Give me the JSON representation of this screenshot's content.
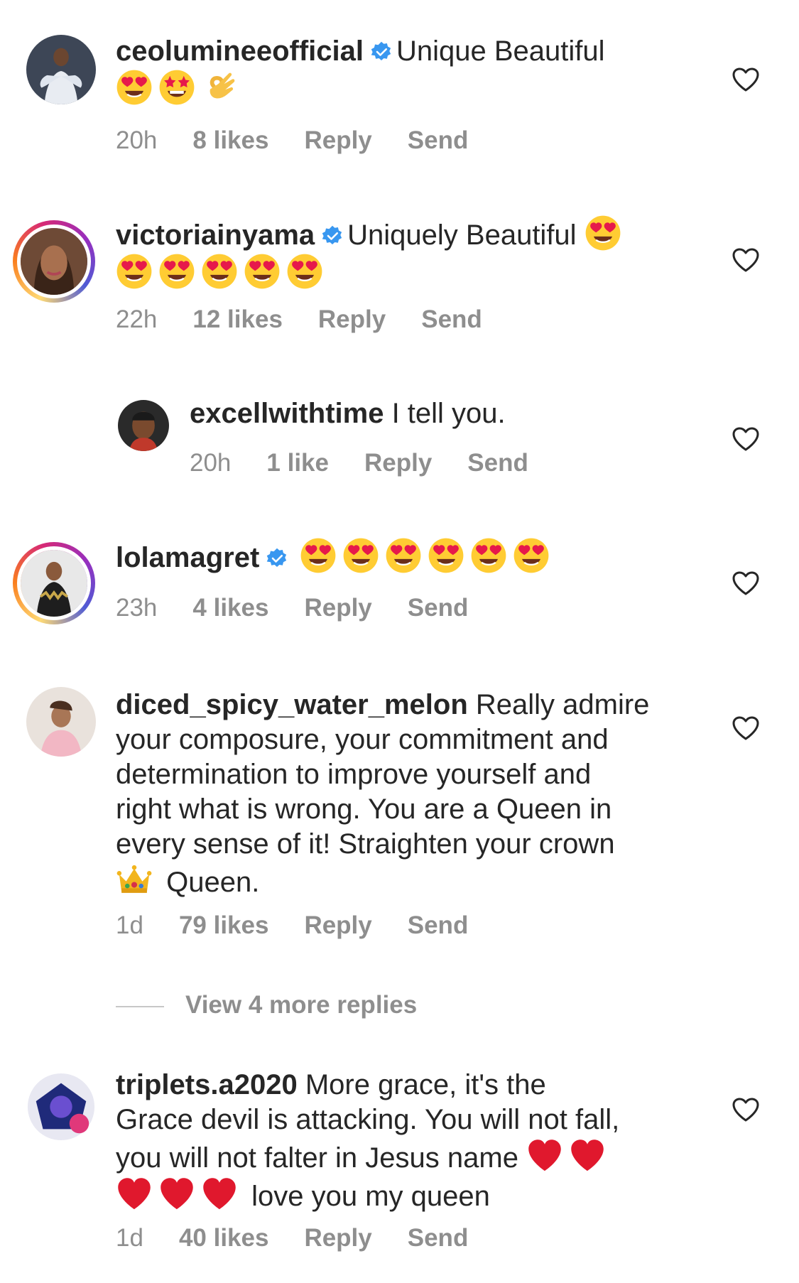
{
  "comments": [
    {
      "username": "ceolumineeofficial",
      "verified": true,
      "text": "Unique Beautiful",
      "emojis_line2": [
        "heart-eyes",
        "star-struck",
        "ok-hand"
      ],
      "time": "20h",
      "likes": "8 likes",
      "reply": "Reply",
      "send": "Send",
      "avatar_style": "ring-none"
    },
    {
      "username": "victoriainyama",
      "verified": true,
      "text": "Uniquely Beautiful",
      "time": "22h",
      "likes": "12 likes",
      "reply": "Reply",
      "send": "Send"
    },
    {
      "username": "excellwithtime",
      "verified": false,
      "text": "I tell you.",
      "time": "20h",
      "likes": "1 like",
      "reply": "Reply",
      "send": "Send"
    },
    {
      "username": "lolamagret",
      "verified": true,
      "time": "23h",
      "likes": "4 likes",
      "reply": "Reply",
      "send": "Send"
    },
    {
      "username": "diced_spicy_water_melon",
      "verified": false,
      "text_lines": [
        " Really admire",
        "your composure, your commitment and",
        "determination to improve yourself and",
        "right what is wrong. You are a Queen in",
        "every sense of it! Straighten your crown",
        " Queen."
      ],
      "time": "1d",
      "likes": "79 likes",
      "reply": "Reply",
      "send": "Send"
    },
    {
      "username": "triplets.a2020",
      "verified": false,
      "text_lines": [
        " More grace,  it's the",
        "Grace devil is attacking.  You will not fall,",
        "you will not falter in Jesus name",
        " love you my queen"
      ],
      "time": "1d",
      "likes": "40 likes",
      "reply": "Reply",
      "send": "Send"
    }
  ],
  "view_more_replies": "View 4 more replies",
  "colors": {
    "text": "#262626",
    "meta": "#8e8e8e",
    "verified": "#3897f0"
  }
}
